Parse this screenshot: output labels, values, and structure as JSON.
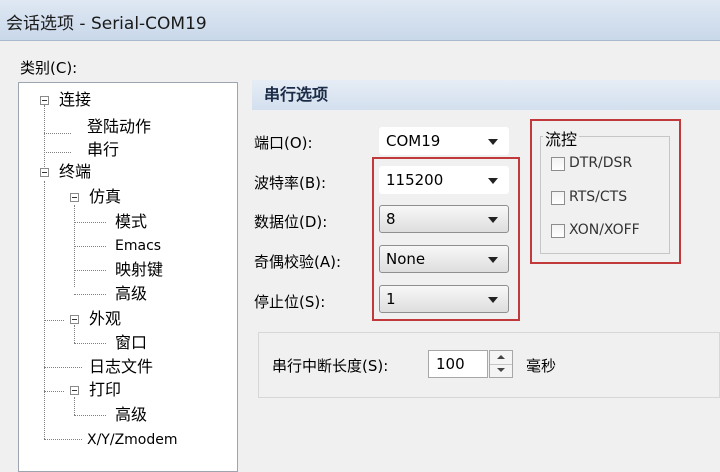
{
  "window": {
    "title": "会话选项 - Serial-COM19"
  },
  "category_label": "类别(C):",
  "tree": {
    "connection": "连接",
    "login_actions": "登陆动作",
    "serial": "串行",
    "terminal": "终端",
    "emulation": "仿真",
    "modes": "模式",
    "emacs": "Emacs",
    "mapped_keys": "映射键",
    "advanced": "高级",
    "appearance": "外观",
    "window": "窗口",
    "log_file": "日志文件",
    "printing": "打印",
    "print_advanced": "高级",
    "xyzmodem": "X/Y/Zmodem"
  },
  "section_title": "串行选项",
  "fields": {
    "port": {
      "label": "端口(O):",
      "value": "COM19"
    },
    "baud": {
      "label": "波特率(B):",
      "value": "115200"
    },
    "data_bits": {
      "label": "数据位(D):",
      "value": "8"
    },
    "parity": {
      "label": "奇偶校验(A):",
      "value": "None"
    },
    "stop_bits": {
      "label": "停止位(S):",
      "value": "1"
    }
  },
  "flow_control": {
    "title": "流控",
    "dtr_dsr": "DTR/DSR",
    "rts_cts": "RTS/CTS",
    "xon_xoff": "XON/XOFF"
  },
  "break_length": {
    "label": "串行中断长度(S):",
    "value": "100",
    "unit": "毫秒"
  },
  "colors": {
    "highlight": "#c2393b",
    "header_text": "#1b2c48"
  }
}
